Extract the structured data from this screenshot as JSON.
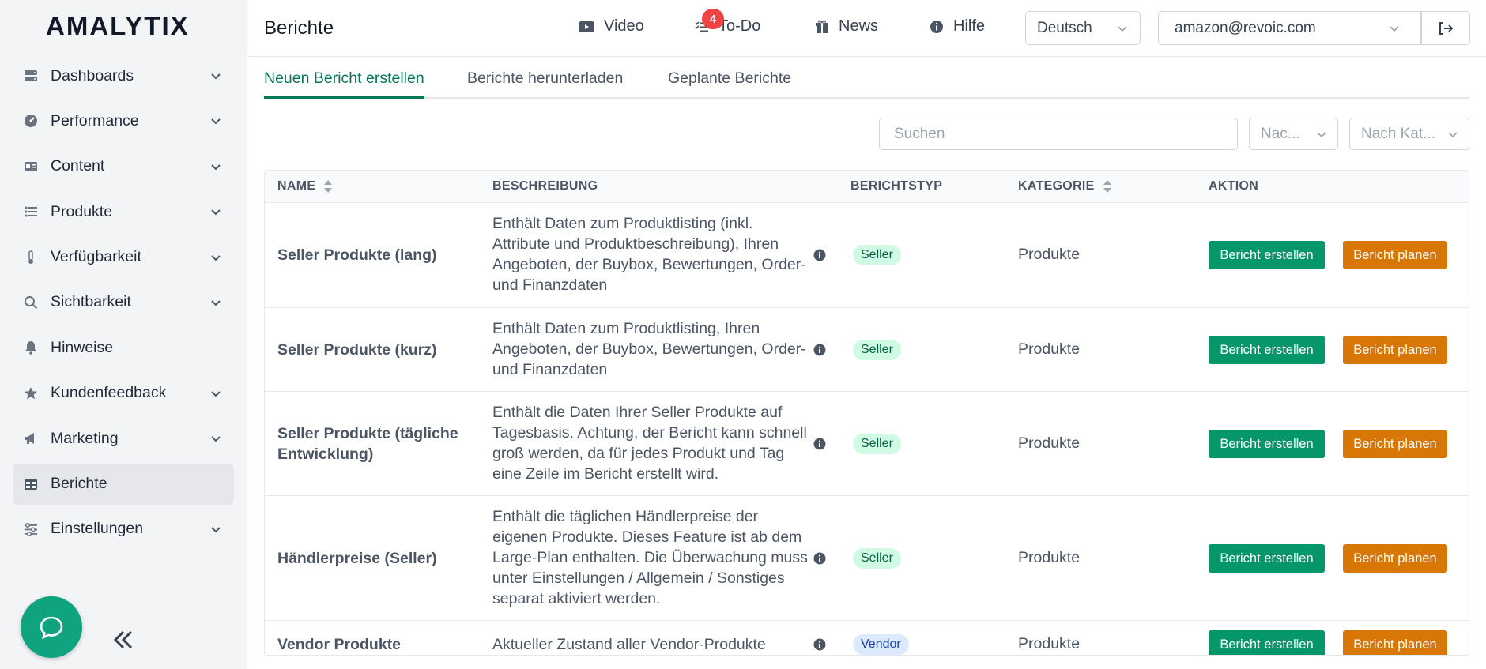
{
  "sidebar": {
    "logo": "AMALYTIX",
    "items": [
      {
        "label": "Dashboards",
        "icon": "server-icon",
        "chevron": true
      },
      {
        "label": "Performance",
        "icon": "gauge-icon",
        "chevron": true
      },
      {
        "label": "Content",
        "icon": "id-card-icon",
        "chevron": true
      },
      {
        "label": "Produkte",
        "icon": "list-icon",
        "chevron": true
      },
      {
        "label": "Verfügbarkeit",
        "icon": "thermometer-icon",
        "chevron": true
      },
      {
        "label": "Sichtbarkeit",
        "icon": "search-icon",
        "chevron": true
      },
      {
        "label": "Hinweise",
        "icon": "bell-icon",
        "chevron": false
      },
      {
        "label": "Kundenfeedback",
        "icon": "star-icon",
        "chevron": true
      },
      {
        "label": "Marketing",
        "icon": "megaphone-icon",
        "chevron": true
      },
      {
        "label": "Berichte",
        "icon": "table-icon",
        "chevron": false,
        "active": true
      },
      {
        "label": "Einstellungen",
        "icon": "sliders-icon",
        "chevron": true
      }
    ]
  },
  "header": {
    "title": "Berichte",
    "video": "Video",
    "todo": "To-Do",
    "todo_badge": "4",
    "news": "News",
    "help": "Hilfe",
    "language": "Deutsch",
    "account": "amazon@revoic.com"
  },
  "tabs": [
    {
      "label": "Neuen Bericht erstellen",
      "active": true
    },
    {
      "label": "Berichte herunterladen"
    },
    {
      "label": "Geplante Berichte"
    }
  ],
  "filters": {
    "search_placeholder": "Suchen",
    "filter1": "Nac...",
    "filter2": "Nach Kat..."
  },
  "table": {
    "headers": {
      "name": "NAME",
      "desc": "BESCHREIBUNG",
      "type": "BERICHTSTYP",
      "category": "KATEGORIE",
      "action": "AKTION"
    },
    "create_label": "Bericht erstellen",
    "plan_label": "Bericht planen",
    "rows": [
      {
        "name": "Seller Produkte (lang)",
        "desc": "Enthält Daten zum Produktlisting (inkl. Attribute und Produktbeschreibung), Ihren Angeboten, der Buybox, Bewertungen, Order- und Finanzdaten",
        "type": "Seller",
        "category": "Produkte"
      },
      {
        "name": "Seller Produkte (kurz)",
        "desc": "Enthält Daten zum Produktlisting, Ihren Angeboten, der Buybox, Bewertungen, Order- und Finanzdaten",
        "type": "Seller",
        "category": "Produkte"
      },
      {
        "name": "Seller Produkte (tägliche Entwicklung)",
        "desc": "Enthält die Daten Ihrer Seller Produkte auf Tagesbasis. Achtung, der Bericht kann schnell groß werden, da für jedes Produkt und Tag eine Zeile im Bericht erstellt wird.",
        "type": "Seller",
        "category": "Produkte"
      },
      {
        "name": "Händlerpreise (Seller)",
        "desc": "Enthält die täglichen Händlerpreise der eigenen Produkte. Dieses Feature ist ab dem Large-Plan enthalten. Die Überwachung muss unter Einstellungen / Allgemein / Sonstiges separat aktiviert werden.",
        "type": "Seller",
        "category": "Produkte"
      },
      {
        "name": "Vendor Produkte",
        "desc": "Aktueller Zustand aller Vendor-Produkte",
        "type": "Vendor",
        "category": "Produkte"
      }
    ]
  }
}
